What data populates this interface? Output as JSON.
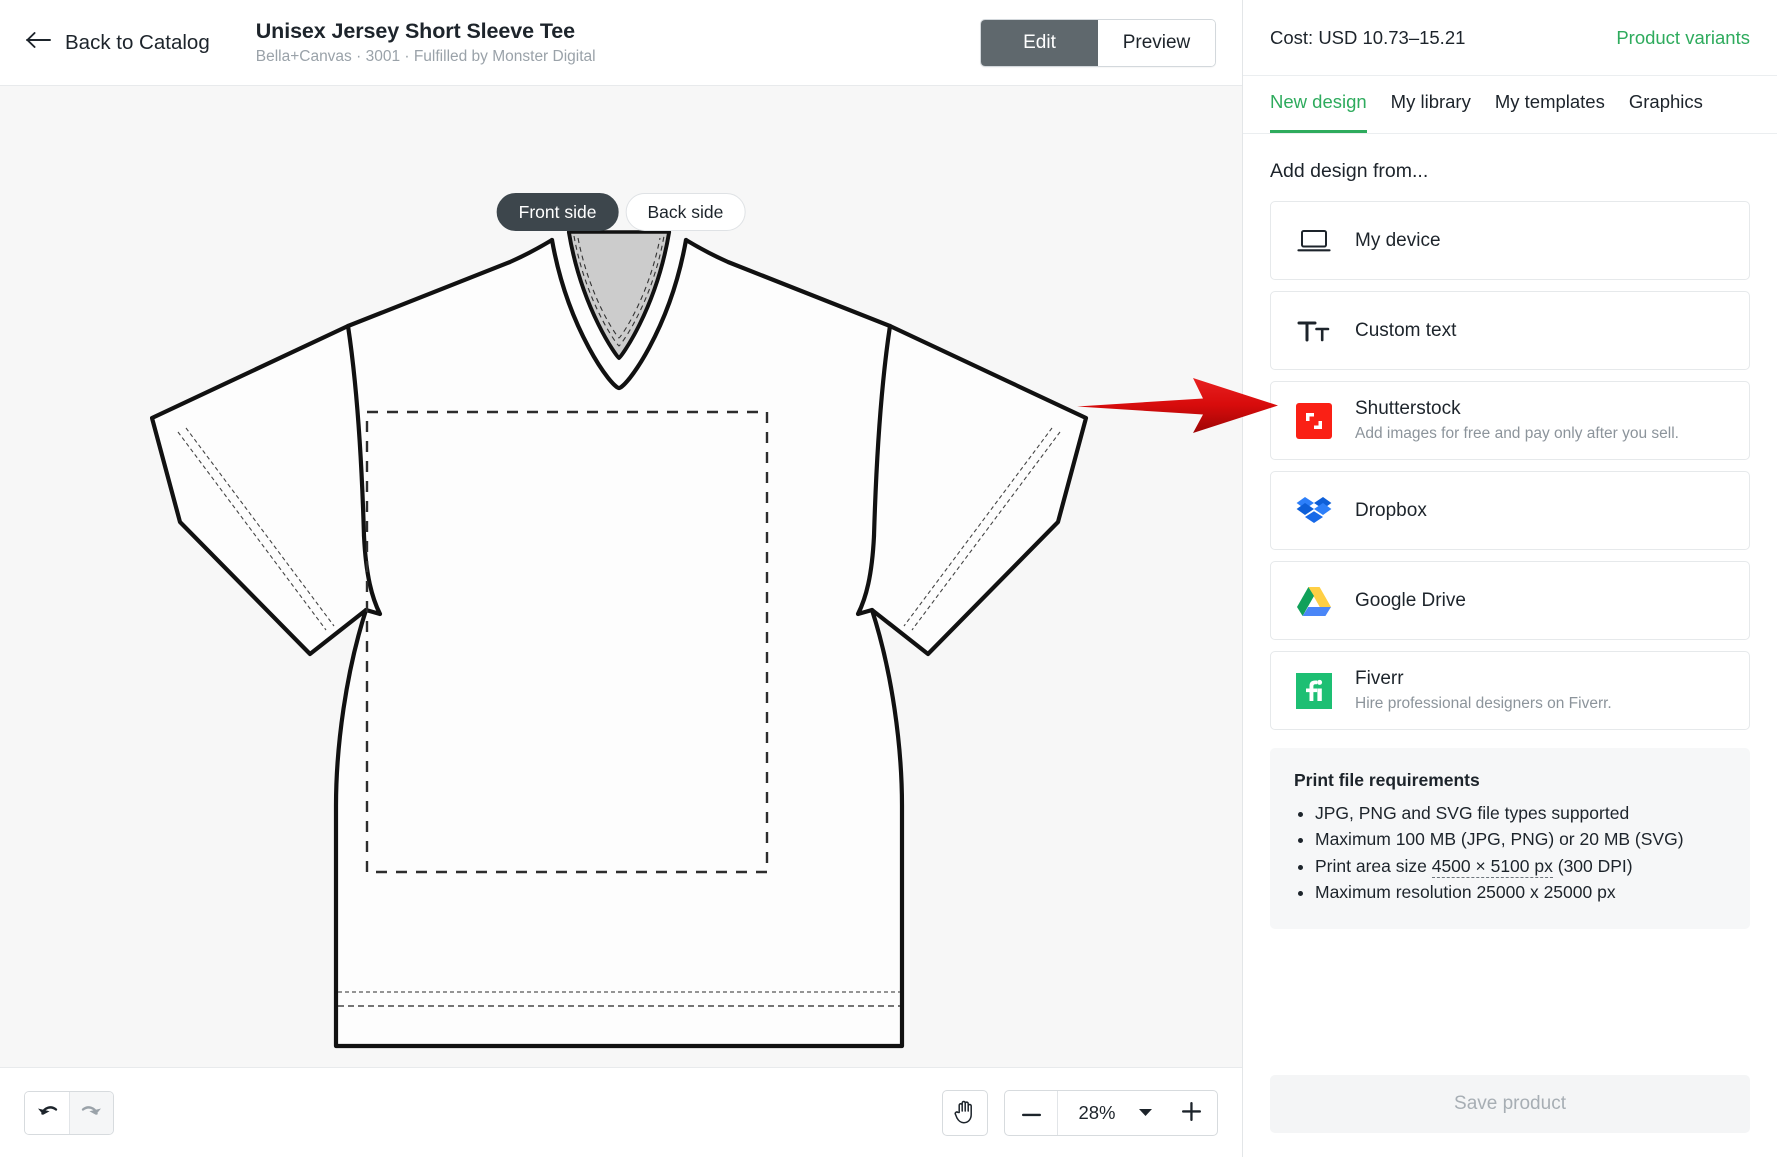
{
  "header": {
    "back_label": "Back to Catalog",
    "back_icon": "arrow-left-icon",
    "product_title": "Unisex Jersey Short Sleeve Tee",
    "product_subtitle": "Bella+Canvas · 3001 · Fulfilled by Monster Digital",
    "mode_buttons": [
      {
        "label": "Edit",
        "active": true
      },
      {
        "label": "Preview",
        "active": false
      }
    ]
  },
  "canvas": {
    "side_toggle": [
      {
        "label": "Front side",
        "active": true
      },
      {
        "label": "Back side",
        "active": false
      }
    ],
    "mockup": "unisex-jersey-short-sleeve-tee-front-outline"
  },
  "bottom_toolbar": {
    "undo_icon": "undo-icon",
    "redo_icon": "redo-icon",
    "pan_icon": "hand-pan-icon",
    "zoom_out_icon": "minus-icon",
    "zoom_in_icon": "plus-icon",
    "zoom_dropdown_icon": "chevron-down-icon",
    "zoom_value": "28%"
  },
  "right_panel": {
    "cost": "Cost: USD 10.73–15.21",
    "variants_link": "Product variants",
    "tabs": [
      {
        "label": "New design",
        "active": true
      },
      {
        "label": "My library",
        "active": false
      },
      {
        "label": "My templates",
        "active": false
      },
      {
        "label": "Graphics",
        "active": false
      }
    ],
    "section_title": "Add design from...",
    "sources": [
      {
        "label": "My device",
        "desc": "",
        "icon": "laptop-icon"
      },
      {
        "label": "Custom text",
        "desc": "",
        "icon": "text-format-icon"
      },
      {
        "label": "Shutterstock",
        "desc": "Add images for free and pay only after you sell.",
        "icon": "shutterstock-icon"
      },
      {
        "label": "Dropbox",
        "desc": "",
        "icon": "dropbox-icon"
      },
      {
        "label": "Google Drive",
        "desc": "",
        "icon": "google-drive-icon"
      },
      {
        "label": "Fiverr",
        "desc": "Hire professional designers on Fiverr.",
        "icon": "fiverr-icon"
      }
    ],
    "requirements": {
      "title": "Print file requirements",
      "items": [
        "JPG, PNG and SVG file types supported",
        "Maximum 100 MB (JPG, PNG) or 20 MB (SVG)",
        "Print area size 4500 × 5100 px (300 DPI)",
        "Maximum resolution 25000 x 25000 px"
      ],
      "print_area_prefix": "Print area size ",
      "print_area_value": "4500 × 5100 px",
      "print_area_suffix": " (300 DPI)"
    },
    "save_label": "Save product"
  },
  "annotation": {
    "arrow": "red-arrow-pointing-right",
    "target": "Shutterstock",
    "color": "#d41111"
  },
  "colors": {
    "accent_green": "#2eab5d",
    "active_segment": "#5f686d",
    "active_pill": "#3d464c",
    "canvas_bg": "#f7f7f7",
    "annotation_red": "#d41111"
  }
}
